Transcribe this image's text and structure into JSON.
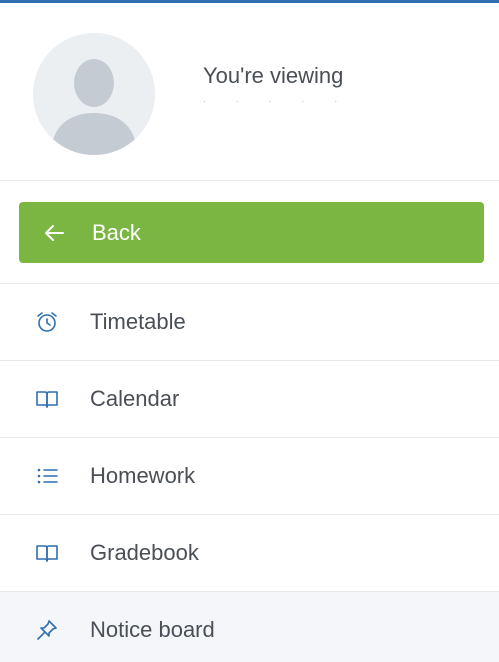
{
  "profile": {
    "viewing_text": "You're viewing",
    "viewing_sub": "· · · · · ·"
  },
  "back": {
    "label": "Back"
  },
  "colors": {
    "accent_green": "#7cb642",
    "icon_blue": "#2f6fb0",
    "text": "#4a4f57"
  },
  "menu": {
    "items": [
      {
        "label": "Timetable",
        "icon": "alarm-clock-icon"
      },
      {
        "label": "Calendar",
        "icon": "book-icon"
      },
      {
        "label": "Homework",
        "icon": "list-icon"
      },
      {
        "label": "Gradebook",
        "icon": "book-icon"
      },
      {
        "label": "Notice board",
        "icon": "pin-icon",
        "active": true
      }
    ]
  }
}
